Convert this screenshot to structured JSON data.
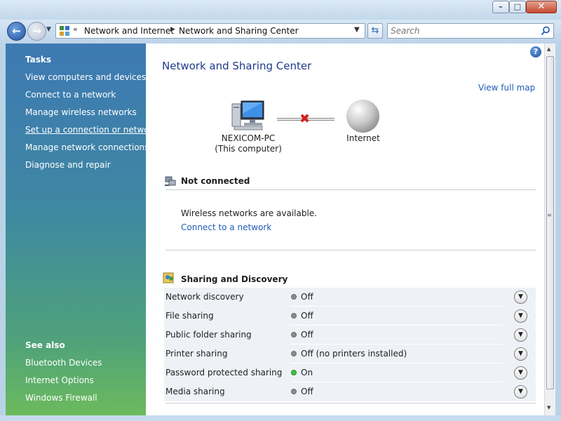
{
  "window": {
    "minimize_glyph": "–",
    "maximize_glyph": "□",
    "close_glyph": "✕"
  },
  "nav": {
    "back_glyph": "←",
    "forward_glyph": "→",
    "recent_glyph": "▼",
    "address_overflow": "«",
    "breadcrumb": [
      "Network and Internet",
      "Network and Sharing Center"
    ],
    "address_drop_glyph": "▼",
    "refresh_glyph": "⇆",
    "search_placeholder": "Search",
    "search_icon": "magnifier-icon"
  },
  "sidebar": {
    "tasks_header": "Tasks",
    "tasks": [
      "View computers and devices",
      "Connect to a network",
      "Manage wireless networks",
      "Set up a connection or network",
      "Manage network connections",
      "Diagnose and repair"
    ],
    "see_also_header": "See also",
    "see_also": [
      "Bluetooth Devices",
      "Internet Options",
      "Windows Firewall"
    ]
  },
  "main": {
    "help_glyph": "?",
    "title": "Network and Sharing Center",
    "view_full_map": "View full map",
    "map": {
      "computer_name": "NEXICOM-PC",
      "computer_sub": "(This computer)",
      "broken_glyph": "✖",
      "internet_label": "Internet"
    },
    "connection": {
      "status": "Not connected",
      "message": "Wireless networks are available.",
      "connect_link": "Connect to a network"
    },
    "sharing": {
      "title": "Sharing and Discovery",
      "expand_glyph": "⌄",
      "rows": [
        {
          "name": "Network discovery",
          "status": "Off"
        },
        {
          "name": "File sharing",
          "status": "Off"
        },
        {
          "name": "Public folder sharing",
          "status": "Off"
        },
        {
          "name": "Printer sharing",
          "status": "Off (no printers installed)"
        },
        {
          "name": "Password protected sharing",
          "status": "On"
        },
        {
          "name": "Media sharing",
          "status": "Off"
        }
      ]
    }
  },
  "colors": {
    "link": "#1f5cb8",
    "status_on": "#3ec23e",
    "status_off": "#8a8a8a"
  }
}
